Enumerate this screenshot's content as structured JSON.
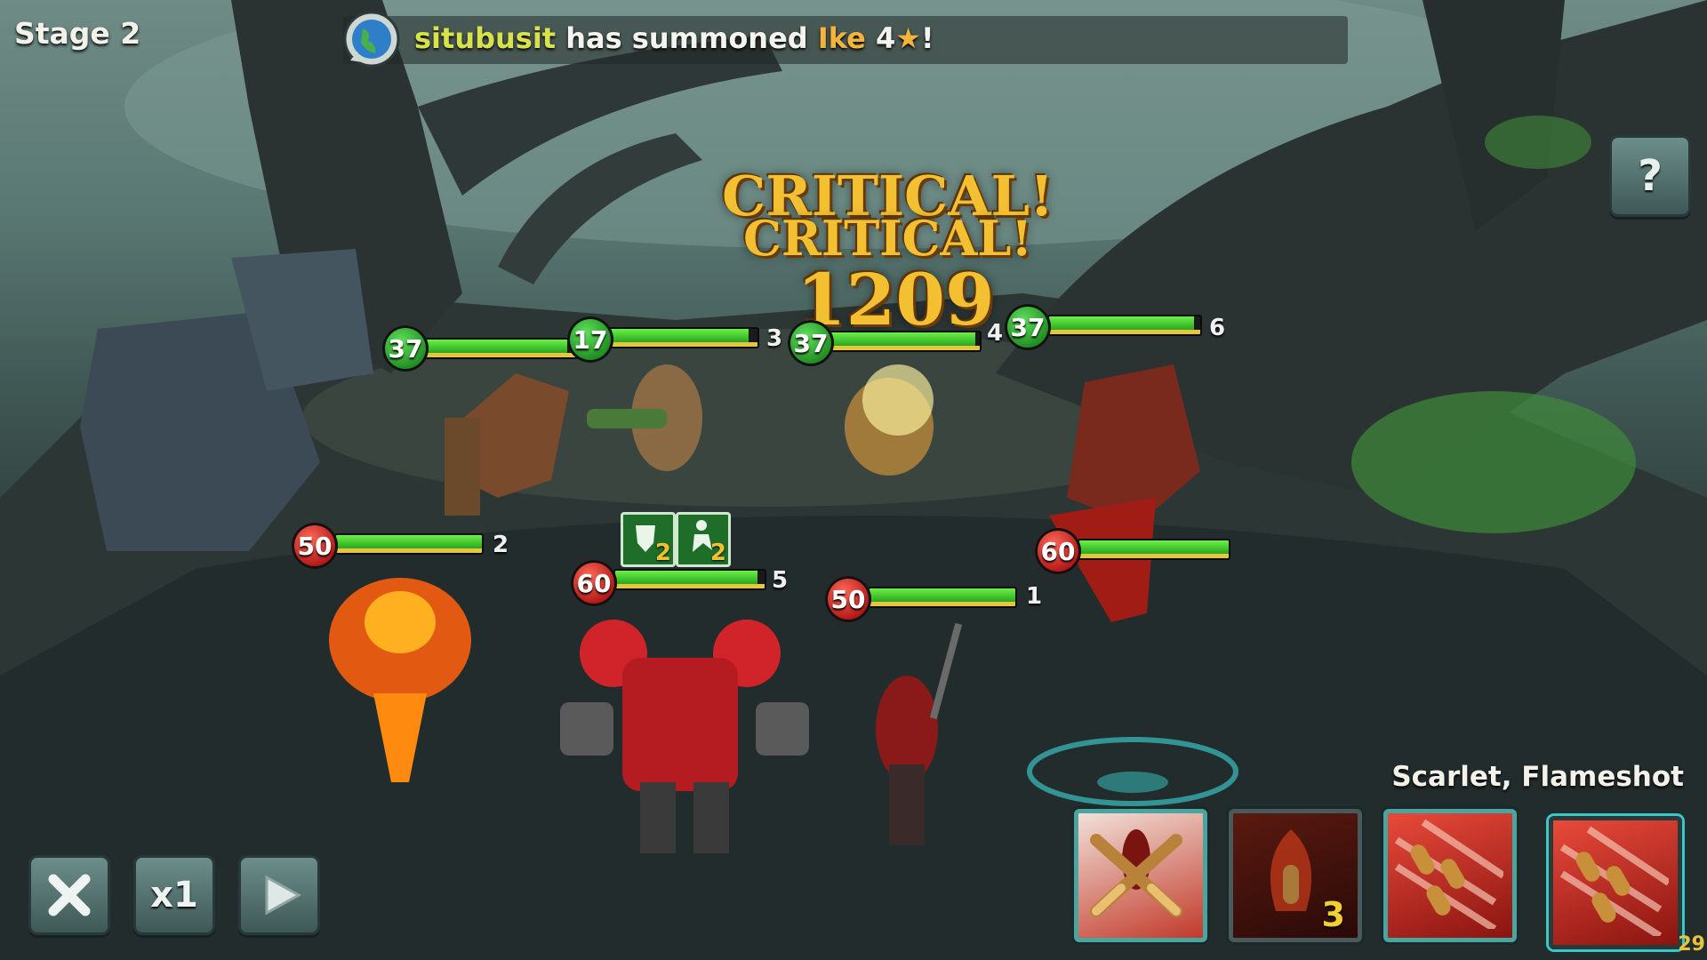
{
  "stage": {
    "label": "Stage 2"
  },
  "summon_message": {
    "player": "situbusit",
    "text": "has summoned",
    "hero": "Ike",
    "stars": "4",
    "star_glyph": "★",
    "end": "!"
  },
  "combat_text": {
    "crit1": "CRITICAL!",
    "crit2": "CRITICAL!",
    "damage": "1209"
  },
  "status_effects": [
    {
      "icon": "shield-buff-icon",
      "turns": "2"
    },
    {
      "icon": "attack-buff-icon",
      "turns": "2"
    }
  ],
  "units": [
    {
      "name": "enemy-werewolf",
      "level": "37",
      "order": "",
      "team": "enemy",
      "hp": 0.92
    },
    {
      "name": "enemy-bazooka-raccoon",
      "level": "17",
      "order": "3",
      "team": "enemy",
      "hp": 0.94
    },
    {
      "name": "enemy-fox-ranger",
      "level": "37",
      "order": "4",
      "team": "enemy",
      "hp": 0.97
    },
    {
      "name": "enemy-armored-knight",
      "level": "37",
      "order": "6",
      "team": "enemy",
      "hp": 0.96
    },
    {
      "name": "ally-fire-demon",
      "level": "50",
      "order": "2",
      "team": "ally",
      "hp": 1.0
    },
    {
      "name": "ally-red-mech",
      "level": "60",
      "order": "5",
      "team": "ally",
      "hp": 0.95
    },
    {
      "name": "ally-scarlet",
      "level": "50",
      "order": "1",
      "team": "ally",
      "hp": 1.0
    },
    {
      "name": "ally-red-caped-hero",
      "level": "60",
      "order": "",
      "team": "ally",
      "hp": 1.0
    }
  ],
  "controls": {
    "close_icon": "close-icon",
    "speed_label": "x1",
    "play_icon": "play-icon",
    "help_icon": "help-book-icon",
    "help_glyph": "?"
  },
  "skills": {
    "active_label": "Scarlet, Flameshot",
    "slots": [
      {
        "name": "skill-crossed-bullets",
        "cooldown": ""
      },
      {
        "name": "skill-flame-bullet",
        "cooldown": "3"
      },
      {
        "name": "skill-bullet-barrage",
        "cooldown": ""
      },
      {
        "name": "skill-bullet-barrage-selected",
        "cooldown": ""
      }
    ]
  },
  "corner_counter": "29",
  "colors": {
    "accent_gold": "#f2c030",
    "player_name": "#d8e24a",
    "hero_name": "#f2b43a",
    "ally_badge": "#d01c1c",
    "enemy_badge": "#2ea82a"
  }
}
